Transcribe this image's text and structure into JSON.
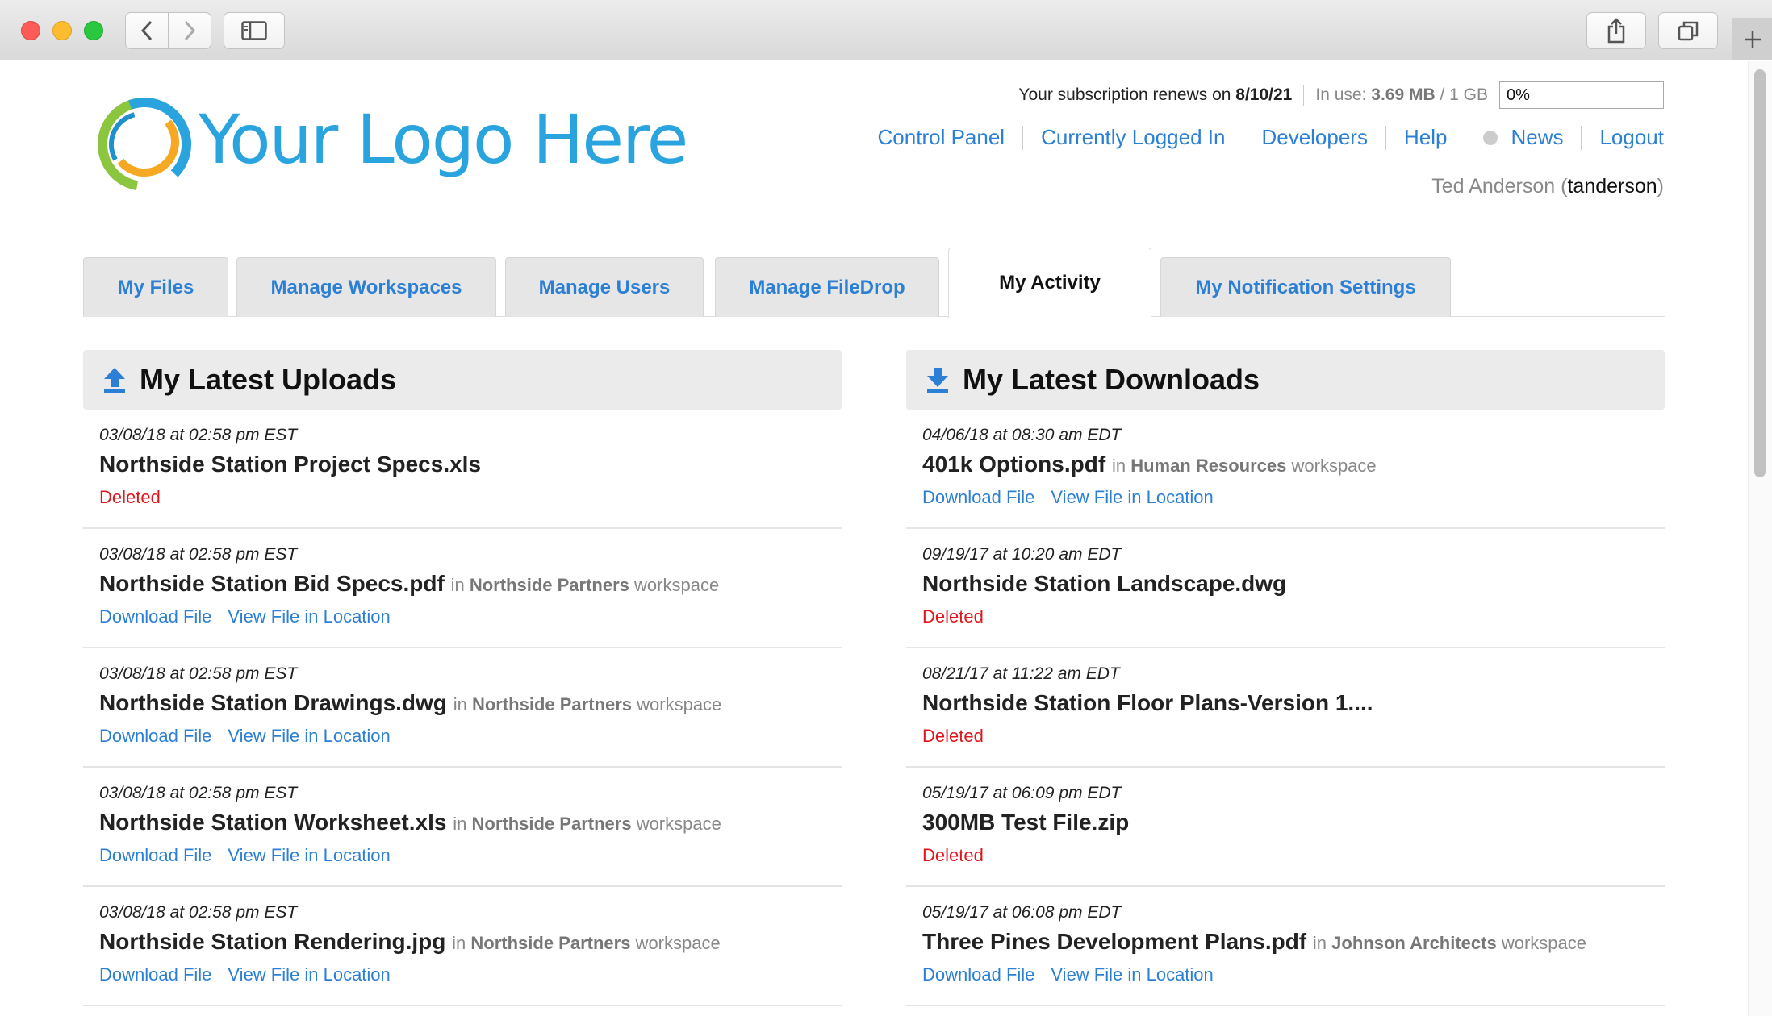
{
  "browser": {
    "icons": [
      "chevron-left-icon",
      "chevron-right-icon",
      "sidebar-icon",
      "share-icon",
      "tabs-icon",
      "plus-icon"
    ]
  },
  "header": {
    "logo_text": "Your Logo Here",
    "subscription_prefix": "Your subscription renews on ",
    "subscription_date": "8/10/21",
    "usage_prefix": "In use: ",
    "usage_value": "3.69 MB",
    "usage_suffix": " / 1 GB",
    "usage_percent": "0%",
    "links": {
      "control_panel": "Control Panel",
      "currently_logged_in": "Currently Logged In",
      "developers": "Developers",
      "help": "Help",
      "news": "News",
      "logout": "Logout"
    },
    "user_name": "Ted Anderson",
    "user_handle": "tanderson"
  },
  "tabs": [
    {
      "label": "My Files"
    },
    {
      "label": "Manage Workspaces"
    },
    {
      "label": "Manage Users"
    },
    {
      "label": "Manage FileDrop"
    },
    {
      "label": "My Activity",
      "active": true
    },
    {
      "label": "My Notification Settings"
    }
  ],
  "uploads": {
    "title": "My Latest Uploads",
    "items": [
      {
        "timestamp": "03/08/18 at 02:58 pm EST",
        "filename": "Northside Station Project Specs.xls",
        "status": "Deleted"
      },
      {
        "timestamp": "03/08/18 at 02:58 pm EST",
        "filename": "Northside Station Bid Specs.pdf",
        "in": "in",
        "workspace": "Northside Partners",
        "workspace_suffix": "workspace",
        "download": "Download File",
        "view": "View File in Location"
      },
      {
        "timestamp": "03/08/18 at 02:58 pm EST",
        "filename": "Northside Station Drawings.dwg",
        "in": "in",
        "workspace": "Northside Partners",
        "workspace_suffix": "workspace",
        "download": "Download File",
        "view": "View File in Location"
      },
      {
        "timestamp": "03/08/18 at 02:58 pm EST",
        "filename": "Northside Station Worksheet.xls",
        "in": "in",
        "workspace": "Northside Partners",
        "workspace_suffix": "workspace",
        "download": "Download File",
        "view": "View File in Location"
      },
      {
        "timestamp": "03/08/18 at 02:58 pm EST",
        "filename": "Northside Station Rendering.jpg",
        "in": "in",
        "workspace": "Northside Partners",
        "workspace_suffix": "workspace",
        "download": "Download File",
        "view": "View File in Location"
      }
    ]
  },
  "downloads": {
    "title": "My Latest Downloads",
    "items": [
      {
        "timestamp": "04/06/18 at 08:30 am EDT",
        "filename": "401k Options.pdf",
        "in": "in",
        "workspace": "Human Resources",
        "workspace_suffix": "workspace",
        "download": "Download File",
        "view": "View File in Location"
      },
      {
        "timestamp": "09/19/17 at 10:20 am EDT",
        "filename": "Northside Station Landscape.dwg",
        "status": "Deleted"
      },
      {
        "timestamp": "08/21/17 at 11:22 am EDT",
        "filename": "Northside Station Floor Plans-Version 1....",
        "status": "Deleted"
      },
      {
        "timestamp": "05/19/17 at 06:09 pm EDT",
        "filename": "300MB Test File.zip",
        "status": "Deleted"
      },
      {
        "timestamp": "05/19/17 at 06:08 pm EDT",
        "filename": "Three Pines Development Plans.pdf",
        "in": "in",
        "workspace": "Johnson Architects",
        "workspace_suffix": "workspace",
        "download": "Download File",
        "view": "View File in Location"
      }
    ]
  }
}
